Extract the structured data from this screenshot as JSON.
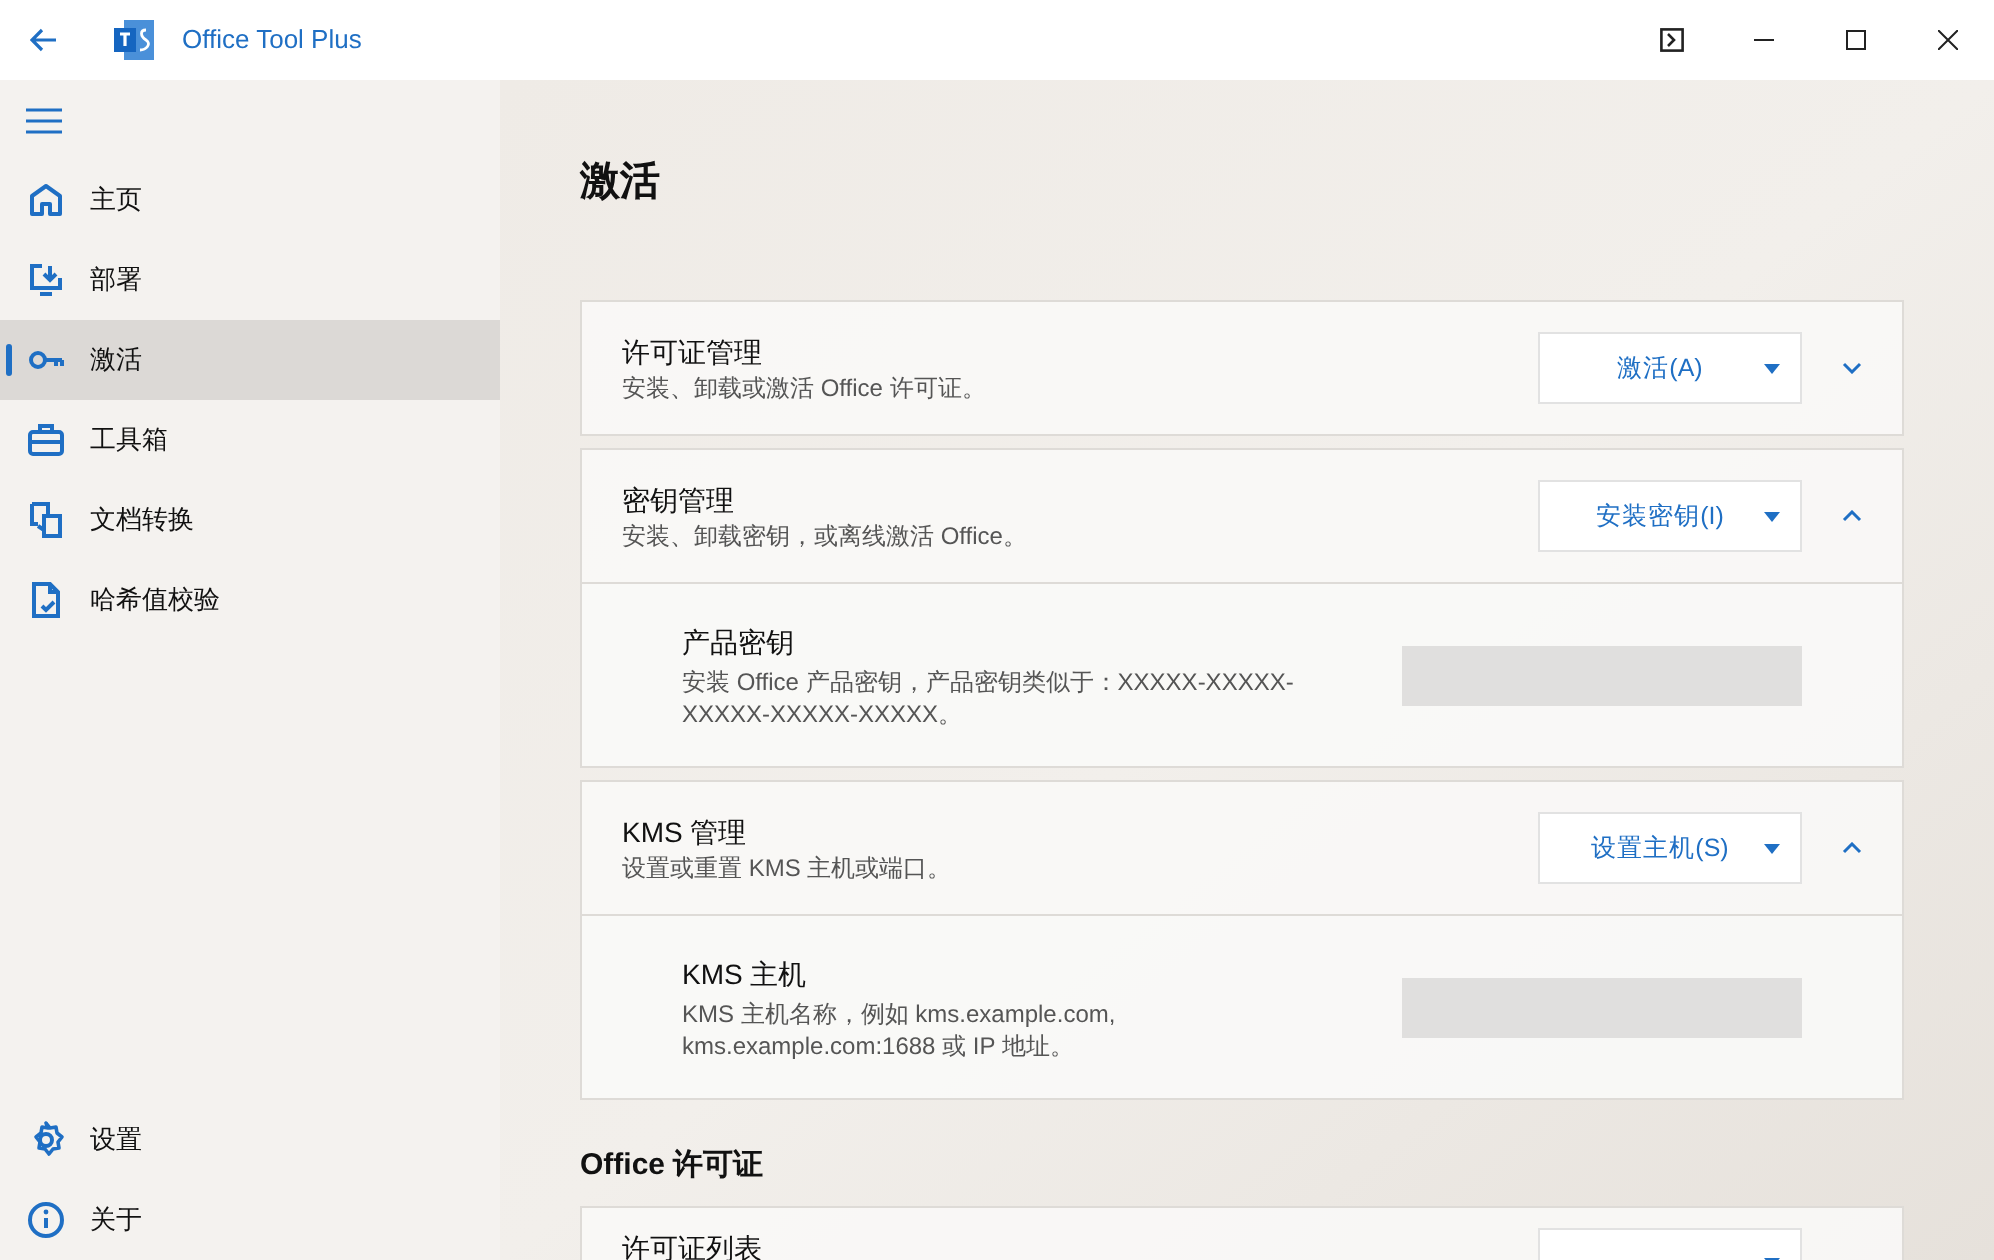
{
  "window": {
    "title": "Office Tool Plus"
  },
  "sidebar": {
    "items": [
      {
        "label": "主页",
        "selected": false
      },
      {
        "label": "部署",
        "selected": false
      },
      {
        "label": "激活",
        "selected": true
      },
      {
        "label": "工具箱",
        "selected": false
      },
      {
        "label": "文档转换",
        "selected": false
      },
      {
        "label": "哈希值校验",
        "selected": false
      }
    ],
    "footer_items": [
      {
        "label": "设置",
        "selected": false
      },
      {
        "label": "关于",
        "selected": false
      }
    ]
  },
  "page": {
    "title": "激活",
    "sections": [
      {
        "title": "许可证管理",
        "description": "安装、卸载或激活 Office 许可证。",
        "button": "激活(A)",
        "expanded": false
      },
      {
        "title": "密钥管理",
        "description": "安装、卸载密钥，或离线激活 Office。",
        "button": "安装密钥(I)",
        "expanded": true,
        "setting": {
          "title": "产品密钥",
          "description": "安装 Office 产品密钥，产品密钥类似于：XXXXX-XXXXX-XXXXX-XXXXX-XXXXX。"
        }
      },
      {
        "title": "KMS 管理",
        "description": "设置或重置 KMS 主机或端口。",
        "button": "设置主机(S)",
        "expanded": true,
        "setting": {
          "title": "KMS 主机",
          "description": "KMS 主机名称，例如 kms.example.com, kms.example.com:1688 或 IP 地址。"
        }
      }
    ],
    "subheading": "Office 许可证",
    "partial_section": {
      "title": "许可证列表"
    }
  }
}
